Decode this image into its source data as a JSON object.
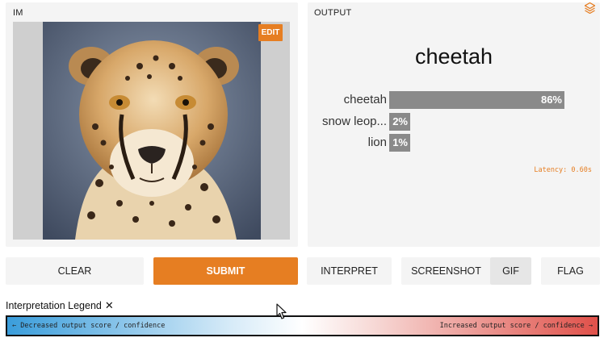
{
  "input_panel": {
    "label": "IM",
    "edit_label": "EDIT"
  },
  "output_panel": {
    "label": "OUTPUT",
    "predicted_label": "cheetah",
    "confidences": [
      {
        "label": "cheetah",
        "percent_text": "86%",
        "value": 0.86
      },
      {
        "label": "snow leop...",
        "percent_text": "2%",
        "value": 0.02
      },
      {
        "label": "lion",
        "percent_text": "1%",
        "value": 0.01
      }
    ],
    "latency": "Latency: 0.60s"
  },
  "buttons": {
    "clear": "CLEAR",
    "submit": "SUBMIT",
    "interpret": "INTERPRET",
    "screenshot": "SCREENSHOT",
    "gif": "GIF",
    "flag": "FLAG"
  },
  "legend": {
    "title": "Interpretation Legend",
    "close": "✕",
    "left_text": "← Decreased output score / confidence",
    "right_text": "Increased output score / confidence →"
  },
  "colors": {
    "accent": "#e67e22",
    "bar": "#8a8a8a",
    "legend_negative": "#3a9ddb",
    "legend_positive": "#e0514a"
  },
  "icons": [
    "edit-icon",
    "app-logo-icon",
    "close-icon",
    "mouse-cursor-icon"
  ]
}
